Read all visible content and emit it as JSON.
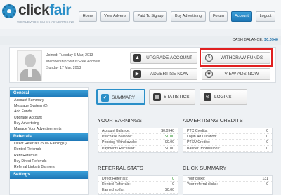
{
  "logo": {
    "part1": "click",
    "part2": "fair",
    "tagline": "WORLDWIDE CLICK ADVERTISING"
  },
  "nav": [
    "Home",
    "Paid To Signup",
    "Buy Advertising",
    "Forum",
    "Account",
    "Logout"
  ],
  "nav_extra": "View Adverts",
  "nav_active": "Account",
  "balance": {
    "label": "CASH BALANCE:",
    "value": "$0.0940"
  },
  "profile": {
    "joined": "Joined: Tuesday 5 Mar, 2013",
    "membership": "Membership Status:Free Account",
    "date": "Sunday 17 Mar, 2013"
  },
  "actions": {
    "upgrade": "UPGRADE ACCOUNT",
    "withdraw": "WITHDRAW FUNDS",
    "advertise": "ADVERTISE NOW",
    "view_ads": "VIEW ADS NOW"
  },
  "sidebar": {
    "general_title": "General",
    "general": [
      "Account Summary",
      "Message System (0)",
      "Add Funds",
      "Upgrade Account",
      "Buy Advertising",
      "Manage Your Advertisements"
    ],
    "referrals_title": "Referrals",
    "referrals": [
      "Direct Referrals (50% Earnings!)",
      "Rented Referrals",
      "Rent Referrals",
      "Buy Direct Referrals",
      "Referral Links & Banners"
    ],
    "settings_title": "Settings"
  },
  "tabs": {
    "summary": "SUMMARY",
    "statistics": "STATISTICS",
    "logins": "LOGINS"
  },
  "earnings": {
    "title": "YOUR EARNINGS",
    "rows": [
      {
        "k": "Account Balance:",
        "v": "$0.0940"
      },
      {
        "k": "Purchase Balance:",
        "v": "$0.00"
      },
      {
        "k": "Pending Withdrawals:",
        "v": "$0.00"
      },
      {
        "k": "Payments Received:",
        "v": "$0.00"
      }
    ]
  },
  "credits": {
    "title": "ADVERTISING CREDITS",
    "rows": [
      {
        "k": "PTC Credits:",
        "v": "0"
      },
      {
        "k": "Login Ad Duration:",
        "v": "0"
      },
      {
        "k": "PTSU Credits:",
        "v": "0"
      },
      {
        "k": "Banner Impressions:",
        "v": "0"
      }
    ]
  },
  "referral_stats": {
    "title": "REFERRAL STATS",
    "rows": [
      {
        "k": "Direct Referrals:",
        "v": "0"
      },
      {
        "k": "Rented Referrals:",
        "v": "0"
      },
      {
        "k": "Earned so far:",
        "v": "$0.00"
      }
    ]
  },
  "click_summary": {
    "title": "CLICK SUMMARY",
    "rows": [
      {
        "k": "Your clicks:",
        "v": "131"
      },
      {
        "k": "Your referral clicks:",
        "v": "0"
      }
    ]
  },
  "colors": {
    "accent": "#2a8fc8",
    "highlight": "#e02020"
  }
}
